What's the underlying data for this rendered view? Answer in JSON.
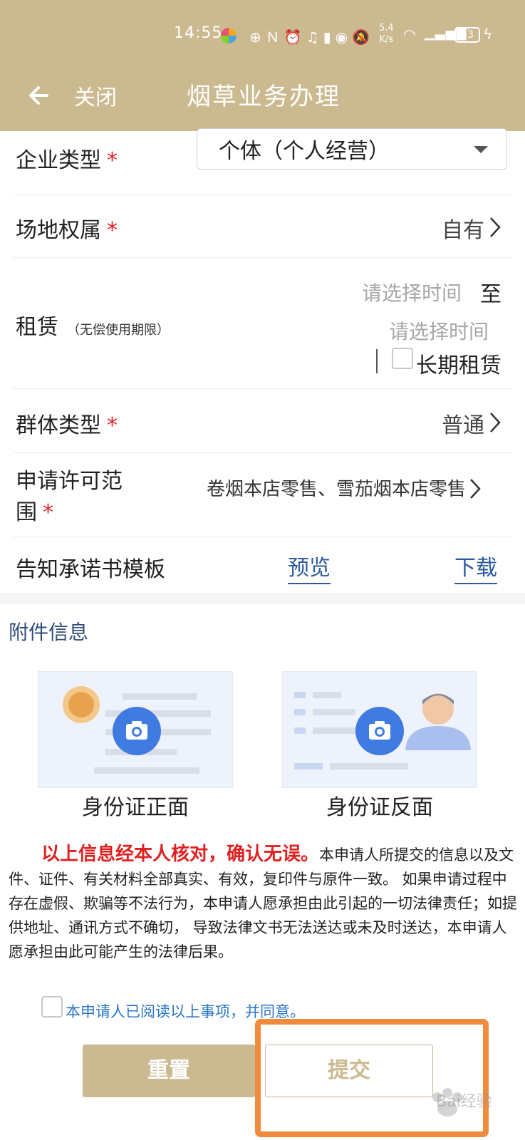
{
  "status_bar": {
    "time": "14:55",
    "speed": "5.4\nK/s",
    "battery": "43"
  },
  "nav": {
    "close_label": "关闭",
    "title": "烟草业务办理"
  },
  "form": {
    "enterprise_type": {
      "label": "企业类型",
      "required": "*",
      "value": "个体（个人经营）"
    },
    "site_ownership": {
      "label": "场地权属",
      "required": "*",
      "value": "自有"
    },
    "lease": {
      "label": "租赁",
      "sub_label": "（无偿使用期限）",
      "start_placeholder": "请选择时间",
      "to_label": "至",
      "end_placeholder": "请选择时间",
      "long_term_label": "长期租赁"
    },
    "group_type": {
      "label": "群体类型",
      "required": "*",
      "value": "普通"
    },
    "license_scope": {
      "label_line1": "申请许可范",
      "label_line2": "围",
      "required": "*",
      "value": "卷烟本店零售、雪茄烟本店零售"
    },
    "commitment_template": {
      "label": "告知承诺书模板",
      "preview_link": "预览",
      "download_link": "下载"
    }
  },
  "attachments": {
    "section_title": "附件信息",
    "id_front_label": "身份证正面",
    "id_back_label": "身份证反面"
  },
  "notice": {
    "strong": "以上信息经本人核对，确认无误。",
    "body": "本申请人所提交的信息以及文件、证件、有关材料全部真实、有效，复印件与原件一致。 如果申请过程中存在虚假、欺骗等不法行为，本申请人愿承担由此引起的一切法律责任；如提供地址、通讯方式不确切， 导致法律文书无法送达或未及时送达，本申请人愿承担由此可能产生的法律后果。",
    "agree_text": "本申请人已阅读以上事项，并同意。"
  },
  "buttons": {
    "reset": "重置",
    "submit": "提交"
  },
  "watermark": "Bai经验",
  "colors": {
    "brand": "#cbb98f",
    "required": "#e02020",
    "link": "#2c5aa0",
    "highlight": "#f08a3c"
  }
}
